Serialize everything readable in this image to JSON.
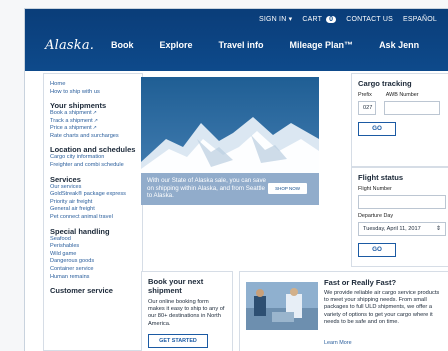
{
  "utility": {
    "sign_in": "SIGN IN ▾",
    "cart_label": "CART",
    "cart_count": "0",
    "contact": "CONTACT US",
    "language": "ESPAÑOL"
  },
  "logo": "Alaska.",
  "nav": [
    "Book",
    "Explore",
    "Travel info",
    "Mileage Plan™",
    "Ask Jenn"
  ],
  "sidebar": {
    "top_links": [
      "Home",
      "How to ship with us"
    ],
    "sections": [
      {
        "title": "Your shipments",
        "links": [
          "Book a shipment",
          "Track a shipment",
          "Price a shipment",
          "Rate charts and surcharges"
        ]
      },
      {
        "title": "Location and schedules",
        "links": [
          "Cargo city information",
          "Freighter and combi schedule"
        ]
      },
      {
        "title": "Services",
        "links": [
          "Our services",
          "GoldStreak® package express",
          "Priority air freight",
          "General air freight",
          "Pet connect animal travel"
        ]
      },
      {
        "title": "Special handling",
        "links": [
          "Seafood",
          "Perishables",
          "Wild game",
          "Dangerous goods",
          "Container service",
          "Human remains"
        ]
      },
      {
        "title": "Customer service",
        "links": []
      }
    ]
  },
  "hero": {
    "text": "With our State of Alaska sale, you can save on shipping within Alaska, and from Seattle to Alaska.",
    "button": "SHOP NOW"
  },
  "cargo_tracking": {
    "title": "Cargo tracking",
    "prefix_label": "Prefix",
    "awb_label": "AWB Number",
    "prefix_value": "027",
    "awb_value": "",
    "go": "GO"
  },
  "flight_status": {
    "title": "Flight status",
    "flight_label": "Flight Number",
    "flight_value": "",
    "date_label": "Departure Day",
    "date_value": "Tuesday, April 11, 2017",
    "go": "GO"
  },
  "book_card": {
    "title": "Book your next shipment",
    "text": "Our online booking form makes it easy to ship to any of our 80+ destinations in North America.",
    "button": "GET STARTED"
  },
  "fast_card": {
    "title": "Fast or Really Fast?",
    "text": "We provide reliable air cargo service products to meet your shipping needs. From small packages to full ULD shipments, we offer a variety of options to get your cargo where it needs to be safe and on time.",
    "link": "Learn More"
  }
}
